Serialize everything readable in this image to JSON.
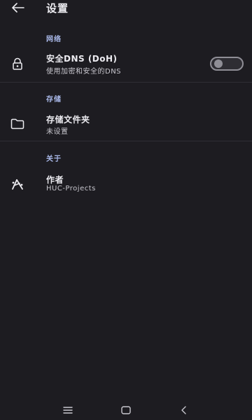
{
  "app_bar": {
    "title": "设置",
    "back_icon": "arrow-left-icon"
  },
  "sections": {
    "network": {
      "header": "网络",
      "doh": {
        "title": "安全DNS (DoH)",
        "subtitle": "使用加密和安全的DNS",
        "icon": "lock-icon",
        "enabled": false
      }
    },
    "storage": {
      "header": "存储",
      "folder": {
        "title": "存储文件夹",
        "subtitle": "未设置",
        "icon": "folder-icon"
      }
    },
    "about": {
      "header": "关于",
      "author": {
        "title": "作者",
        "subtitle": "HUC-Projects",
        "icon": "author-logo-icon"
      }
    }
  },
  "nav_bar": {
    "menu_icon": "recents-icon",
    "home_icon": "home-icon",
    "back_icon": "back-chevron-icon"
  },
  "colors": {
    "background": "#1d1c21",
    "accent": "#a9b8e8",
    "text": "#ecebf0",
    "subtext": "#c9c8cf",
    "divider": "#2f2e35"
  }
}
